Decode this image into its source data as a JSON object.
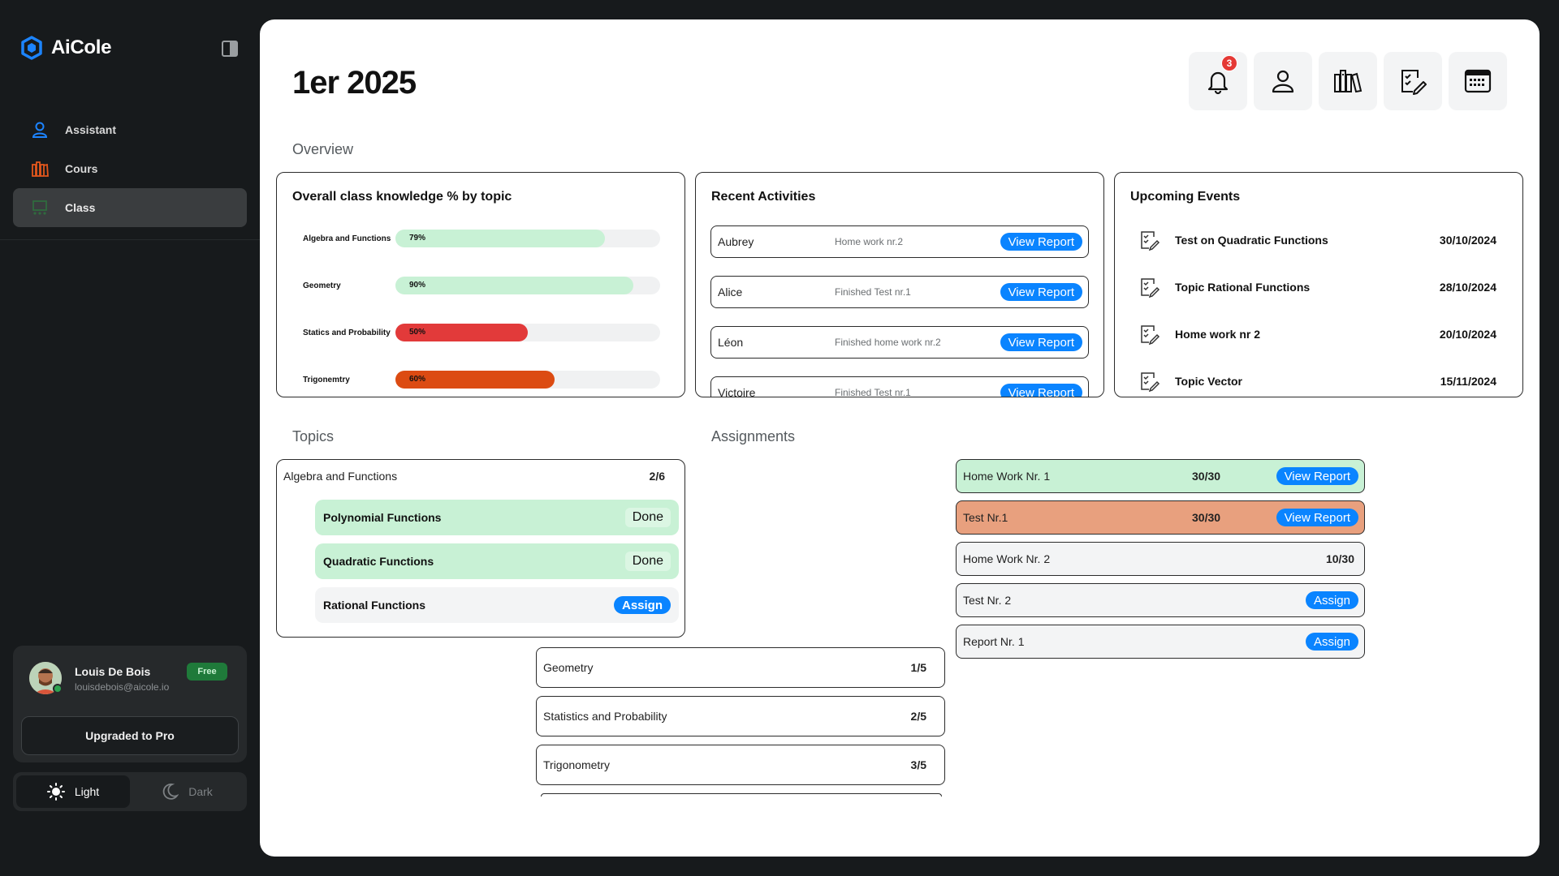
{
  "app": {
    "name": "AiCole"
  },
  "nav": {
    "items": [
      {
        "label": "Assistant"
      },
      {
        "label": "Cours"
      },
      {
        "label": "Class"
      }
    ]
  },
  "user": {
    "name": "Louis De Bois",
    "email": "louisdebois@aicole.io",
    "plan": "Free",
    "upgrade_label": "Upgraded to Pro"
  },
  "theme": {
    "light": "Light",
    "dark": "Dark",
    "selected": "Light"
  },
  "page": {
    "title": "1er 2025"
  },
  "notifications": {
    "count": "3"
  },
  "sections": {
    "overview": "Overview",
    "topics": "Topics",
    "assignments": "Assignments"
  },
  "knowledge": {
    "title": "Overall class knowledge % by topic",
    "rows": [
      {
        "label": "Algebra and Functions",
        "pct": "79%",
        "value": 79,
        "color": "#c8f1d5"
      },
      {
        "label": "Geometry",
        "pct": "90%",
        "value": 90,
        "color": "#c8f1d5"
      },
      {
        "label": "Statics and Probability",
        "pct": "50%",
        "value": 50,
        "color": "#e23a3a"
      },
      {
        "label": "Trigonemtry",
        "pct": "60%",
        "value": 60,
        "color": "#dc4b12"
      }
    ]
  },
  "activities": {
    "title": "Recent Activities",
    "button_label": "View Report",
    "rows": [
      {
        "name": "Aubrey",
        "desc": "Home work nr.2"
      },
      {
        "name": "Alice",
        "desc": "Finished Test nr.1"
      },
      {
        "name": "Léon",
        "desc": "Finished home work nr.2"
      },
      {
        "name": "Victoire",
        "desc": "Finished Test nr.1"
      }
    ]
  },
  "events": {
    "title": "Upcoming Events",
    "rows": [
      {
        "name": "Test on Quadratic Functions",
        "date": "30/10/2024"
      },
      {
        "name": "Topic Rational Functions",
        "date": "28/10/2024"
      },
      {
        "name": "Home work nr 2",
        "date": "20/10/2024"
      },
      {
        "name": "Topic Vector",
        "date": "15/11/2024"
      }
    ]
  },
  "topics": {
    "expanded": {
      "name": "Algebra and Functions",
      "count": "2/6",
      "subtopics": [
        {
          "name": "Polynomial Functions",
          "status": "Done",
          "color": "#c8f1d5"
        },
        {
          "name": "Quadratic Functions",
          "status": "Done",
          "color": "#c8f1d5"
        },
        {
          "name": "Rational Functions",
          "status": "Assign",
          "color": "#f3f4f5"
        }
      ]
    },
    "rows": [
      {
        "name": "Geometry",
        "count": "1/5"
      },
      {
        "name": "Statistics and Probability",
        "count": "2/5"
      },
      {
        "name": "Trigonometry",
        "count": "3/5"
      }
    ]
  },
  "assignments": {
    "rows": [
      {
        "name": "Home Work Nr. 1",
        "score": "30/30",
        "action": "View Report",
        "color": "#c8f1d5"
      },
      {
        "name": "Test Nr.1",
        "score": "30/30",
        "action": "View Report",
        "color": "#e8a07e"
      },
      {
        "name": "Home Work Nr. 2",
        "score": "10/30",
        "action": "",
        "color": "#f3f4f5"
      },
      {
        "name": "Test Nr. 2",
        "score": "",
        "action": "Assign",
        "color": "#f3f4f5"
      },
      {
        "name": "Report Nr. 1",
        "score": "",
        "action": "Assign",
        "color": "#f3f4f5"
      }
    ]
  },
  "colors": {
    "accent": "#0a84ff",
    "done": "#c8f1d5",
    "danger": "#e23a3a",
    "warning": "#dc4b12",
    "test_row": "#e8a07e"
  },
  "icons": [
    "aicole-logo-icon",
    "sidebar-toggle-icon",
    "person-icon",
    "books-icon",
    "class-icon",
    "sun-icon",
    "moon-icon",
    "bell-icon",
    "user-icon",
    "library-icon",
    "checklist-edit-icon",
    "calendar-icon"
  ]
}
